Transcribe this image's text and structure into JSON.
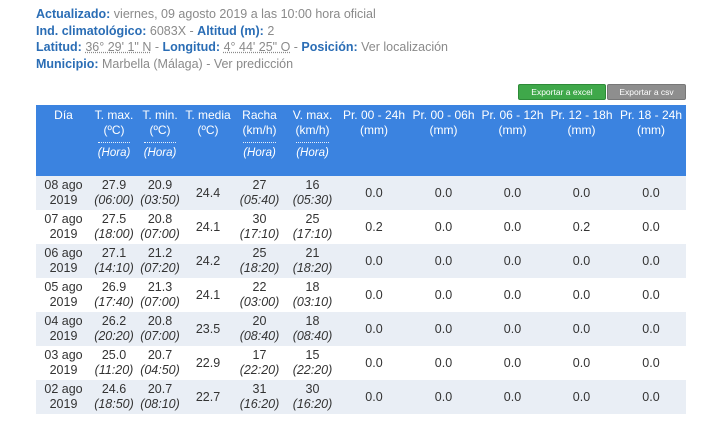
{
  "info": {
    "actualizado_label": "Actualizado:",
    "actualizado_value": "viernes, 09 agosto 2019 a las 10:00 hora oficial",
    "ind_label": "Ind. climatológico:",
    "ind_value": "6083X",
    "altitud_label": "Altitud (m):",
    "altitud_value": "2",
    "latitud_label": "Latitud:",
    "latitud_value": "36° 29' 1\" N",
    "longitud_label": "Longitud:",
    "longitud_value": "4° 44' 25\" O",
    "posicion_label": "Posición:",
    "posicion_link": "Ver localización",
    "municipio_label": "Municipio:",
    "municipio_value": "Marbella (Málaga)",
    "prediccion_link": "Ver predicción"
  },
  "buttons": {
    "excel": "Exportar a excel",
    "csv": "Exportar a csv"
  },
  "table": {
    "headers": [
      {
        "l1": "Día",
        "l2": "",
        "sub": ""
      },
      {
        "l1": "T. max.",
        "l2": "(ºC)",
        "sub": "(Hora)"
      },
      {
        "l1": "T. min.",
        "l2": "(ºC)",
        "sub": "(Hora)"
      },
      {
        "l1": "T. media",
        "l2": "(ºC)",
        "sub": ""
      },
      {
        "l1": "Racha",
        "l2": "(km/h)",
        "sub": "(Hora)"
      },
      {
        "l1": "V. max.",
        "l2": "(km/h)",
        "sub": "(Hora)"
      },
      {
        "l1": "Pr. 00 - 24h",
        "l2": "(mm)",
        "sub": ""
      },
      {
        "l1": "Pr. 00 - 06h",
        "l2": "(mm)",
        "sub": ""
      },
      {
        "l1": "Pr. 06 - 12h",
        "l2": "(mm)",
        "sub": ""
      },
      {
        "l1": "Pr. 12 - 18h",
        "l2": "(mm)",
        "sub": ""
      },
      {
        "l1": "Pr. 18 - 24h",
        "l2": "(mm)",
        "sub": ""
      }
    ],
    "rows": [
      {
        "d1": "08 ago",
        "d2": "2019",
        "tmax": "27.9",
        "tmax_h": "(06:00)",
        "tmin": "20.9",
        "tmin_h": "(03:50)",
        "tmed": "24.4",
        "racha": "27",
        "racha_h": "(05:40)",
        "vmax": "16",
        "vmax_h": "(05:30)",
        "p1": "0.0",
        "p2": "0.0",
        "p3": "0.0",
        "p4": "0.0",
        "p5": "0.0"
      },
      {
        "d1": "07 ago",
        "d2": "2019",
        "tmax": "27.5",
        "tmax_h": "(18:00)",
        "tmin": "20.8",
        "tmin_h": "(07:00)",
        "tmed": "24.1",
        "racha": "30",
        "racha_h": "(17:10)",
        "vmax": "25",
        "vmax_h": "(17:10)",
        "p1": "0.2",
        "p2": "0.0",
        "p3": "0.0",
        "p4": "0.2",
        "p5": "0.0"
      },
      {
        "d1": "06 ago",
        "d2": "2019",
        "tmax": "27.1",
        "tmax_h": "(14:10)",
        "tmin": "21.2",
        "tmin_h": "(07:20)",
        "tmed": "24.2",
        "racha": "25",
        "racha_h": "(18:20)",
        "vmax": "21",
        "vmax_h": "(18:20)",
        "p1": "0.0",
        "p2": "0.0",
        "p3": "0.0",
        "p4": "0.0",
        "p5": "0.0"
      },
      {
        "d1": "05 ago",
        "d2": "2019",
        "tmax": "26.9",
        "tmax_h": "(17:40)",
        "tmin": "21.3",
        "tmin_h": "(07:00)",
        "tmed": "24.1",
        "racha": "22",
        "racha_h": "(03:00)",
        "vmax": "18",
        "vmax_h": "(03:10)",
        "p1": "0.0",
        "p2": "0.0",
        "p3": "0.0",
        "p4": "0.0",
        "p5": "0.0"
      },
      {
        "d1": "04 ago",
        "d2": "2019",
        "tmax": "26.2",
        "tmax_h": "(20:20)",
        "tmin": "20.8",
        "tmin_h": "(07:00)",
        "tmed": "23.5",
        "racha": "20",
        "racha_h": "(08:40)",
        "vmax": "18",
        "vmax_h": "(08:40)",
        "p1": "0.0",
        "p2": "0.0",
        "p3": "0.0",
        "p4": "0.0",
        "p5": "0.0"
      },
      {
        "d1": "03 ago",
        "d2": "2019",
        "tmax": "25.0",
        "tmax_h": "(11:20)",
        "tmin": "20.7",
        "tmin_h": "(04:50)",
        "tmed": "22.9",
        "racha": "17",
        "racha_h": "(22:20)",
        "vmax": "15",
        "vmax_h": "(22:20)",
        "p1": "0.0",
        "p2": "0.0",
        "p3": "0.0",
        "p4": "0.0",
        "p5": "0.0"
      },
      {
        "d1": "02 ago",
        "d2": "2019",
        "tmax": "24.6",
        "tmax_h": "(18:50)",
        "tmin": "20.7",
        "tmin_h": "(08:10)",
        "tmed": "22.7",
        "racha": "31",
        "racha_h": "(16:20)",
        "vmax": "30",
        "vmax_h": "(16:20)",
        "p1": "0.0",
        "p2": "0.0",
        "p3": "0.0",
        "p4": "0.0",
        "p5": "0.0"
      }
    ]
  }
}
